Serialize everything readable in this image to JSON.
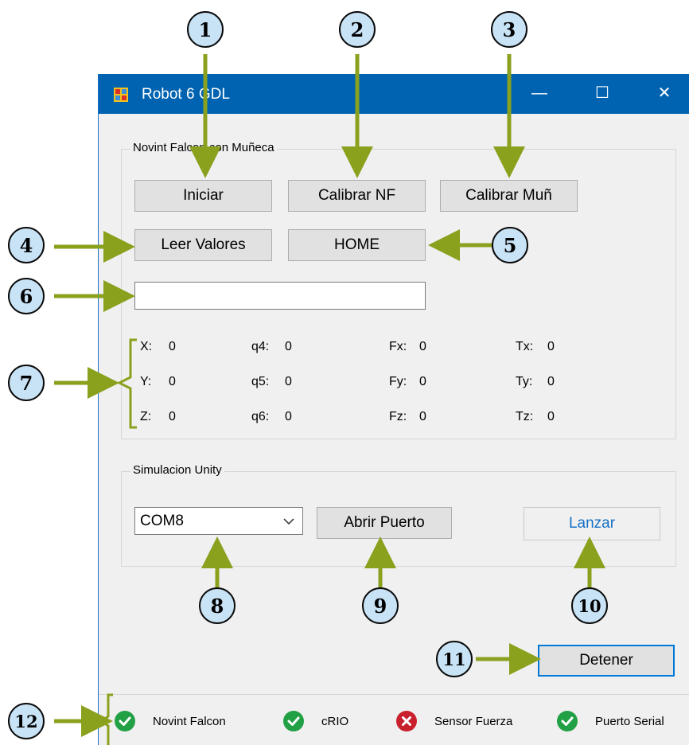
{
  "window": {
    "title": "Robot 6 GDL",
    "minimize": "—",
    "maximize": "☐",
    "close": "✕"
  },
  "falcon_group": {
    "legend": "Novint Falcon con Muñeca",
    "iniciar": "Iniciar",
    "calibrar_nf": "Calibrar NF",
    "calibrar_mun": "Calibrar Muñ",
    "leer_valores": "Leer Valores",
    "home": "HOME",
    "text_value": "",
    "values": [
      {
        "label": "X:",
        "value": "0"
      },
      {
        "label": "q4:",
        "value": "0"
      },
      {
        "label": "Fx:",
        "value": "0"
      },
      {
        "label": "Tx:",
        "value": "0"
      },
      {
        "label": "Y:",
        "value": "0"
      },
      {
        "label": "q5:",
        "value": "0"
      },
      {
        "label": "Fy:",
        "value": "0"
      },
      {
        "label": "Ty:",
        "value": "0"
      },
      {
        "label": "Z:",
        "value": "0"
      },
      {
        "label": "q6:",
        "value": "0"
      },
      {
        "label": "Fz:",
        "value": "0"
      },
      {
        "label": "Tz:",
        "value": "0"
      }
    ]
  },
  "unity_group": {
    "legend": "Simulacion Unity",
    "port_selected": "COM8",
    "abrir_puerto": "Abrir Puerto",
    "lanzar": "Lanzar"
  },
  "detener": "Detener",
  "status": [
    {
      "label": "Novint Falcon",
      "state": "ok"
    },
    {
      "label": "cRIO",
      "state": "ok"
    },
    {
      "label": "Sensor Fuerza",
      "state": "error"
    },
    {
      "label": "Puerto Serial",
      "state": "ok"
    }
  ],
  "colors": {
    "ok": "#22a045",
    "error": "#c8202c",
    "arrow": "#8aa11e",
    "titlebar": "#0063b1",
    "badge": "#c9e3f6"
  },
  "badges": [
    "1",
    "2",
    "3",
    "4",
    "5",
    "6",
    "7",
    "8",
    "9",
    "10",
    "11",
    "12"
  ]
}
